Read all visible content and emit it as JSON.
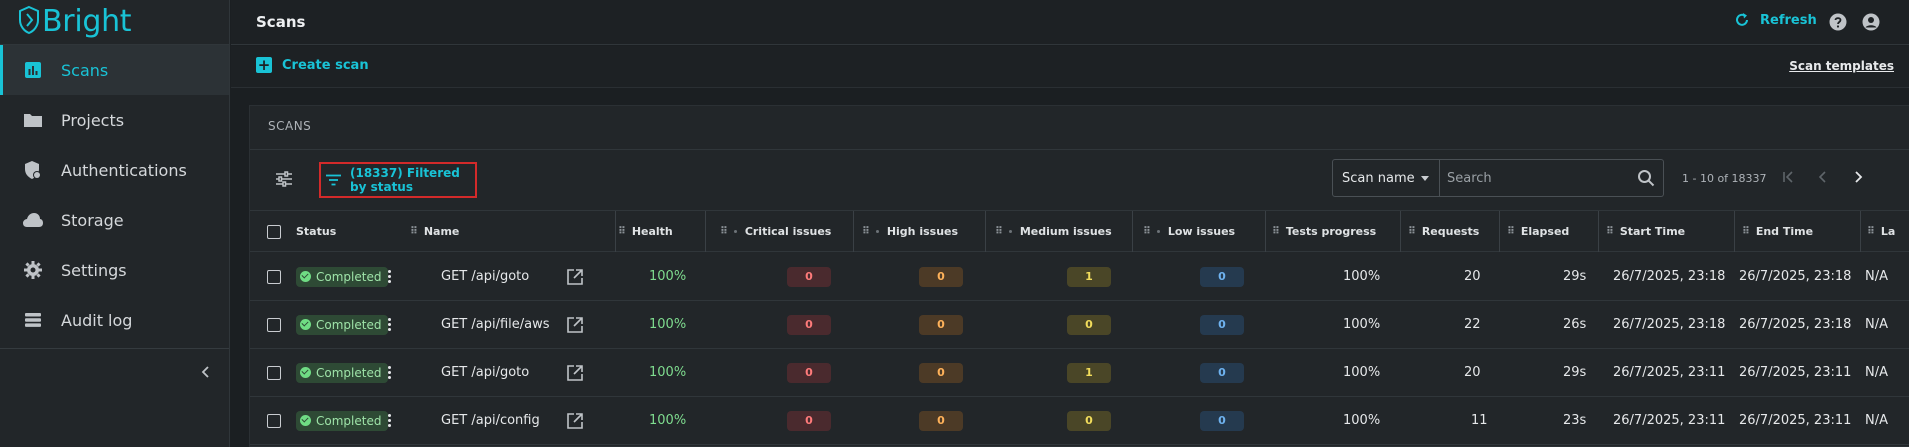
{
  "brand": {
    "name": "Bright",
    "accent": "#19c3d6"
  },
  "sidebar": {
    "items": [
      {
        "label": "Scans",
        "icon": "bar-chart-icon",
        "active": true
      },
      {
        "label": "Projects",
        "icon": "folder-icon",
        "active": false
      },
      {
        "label": "Authentications",
        "icon": "shield-lock-icon",
        "active": false
      },
      {
        "label": "Storage",
        "icon": "cloud-icon",
        "active": false
      },
      {
        "label": "Settings",
        "icon": "gear-icon",
        "active": false
      },
      {
        "label": "Audit log",
        "icon": "list-icon",
        "active": false
      }
    ],
    "collapse_icon": "chevron-left-icon"
  },
  "header": {
    "title": "Scans",
    "refresh_label": "Refresh",
    "help_icon": "help-icon",
    "account_icon": "account-icon"
  },
  "actionbar": {
    "create_label": "Create scan",
    "templates_label": "Scan templates"
  },
  "card": {
    "title": "SCANS",
    "filter_label": "(18337) Filtered by status",
    "search_field": {
      "selected": "Scan name",
      "placeholder": "Search"
    },
    "pagination": {
      "text": "1 - 10 of 18337"
    }
  },
  "table": {
    "columns": [
      "Status",
      "Name",
      "Health",
      "Critical issues",
      "High issues",
      "Medium issues",
      "Low issues",
      "Tests progress",
      "Requests",
      "Elapsed",
      "Start Time",
      "End Time",
      "La"
    ],
    "rows": [
      {
        "status": "Completed",
        "name": "GET /api/goto",
        "health": "100%",
        "critical": "0",
        "high": "0",
        "medium": "1",
        "low": "0",
        "progress": "100%",
        "requests": "20",
        "elapsed": "29s",
        "start": "26/7/2025, 23:18",
        "end": "26/7/2025, 23:18",
        "last": "N/A"
      },
      {
        "status": "Completed",
        "name": "GET /api/file/aws",
        "health": "100%",
        "critical": "0",
        "high": "0",
        "medium": "0",
        "low": "0",
        "progress": "100%",
        "requests": "22",
        "elapsed": "26s",
        "start": "26/7/2025, 23:18",
        "end": "26/7/2025, 23:18",
        "last": "N/A"
      },
      {
        "status": "Completed",
        "name": "GET /api/goto",
        "health": "100%",
        "critical": "0",
        "high": "0",
        "medium": "1",
        "low": "0",
        "progress": "100%",
        "requests": "20",
        "elapsed": "29s",
        "start": "26/7/2025, 23:11",
        "end": "26/7/2025, 23:11",
        "last": "N/A"
      },
      {
        "status": "Completed",
        "name": "GET /api/config",
        "health": "100%",
        "critical": "0",
        "high": "0",
        "medium": "0",
        "low": "0",
        "progress": "100%",
        "requests": "11",
        "elapsed": "23s",
        "start": "26/7/2025, 23:11",
        "end": "26/7/2025, 23:11",
        "last": "N/A"
      }
    ]
  }
}
